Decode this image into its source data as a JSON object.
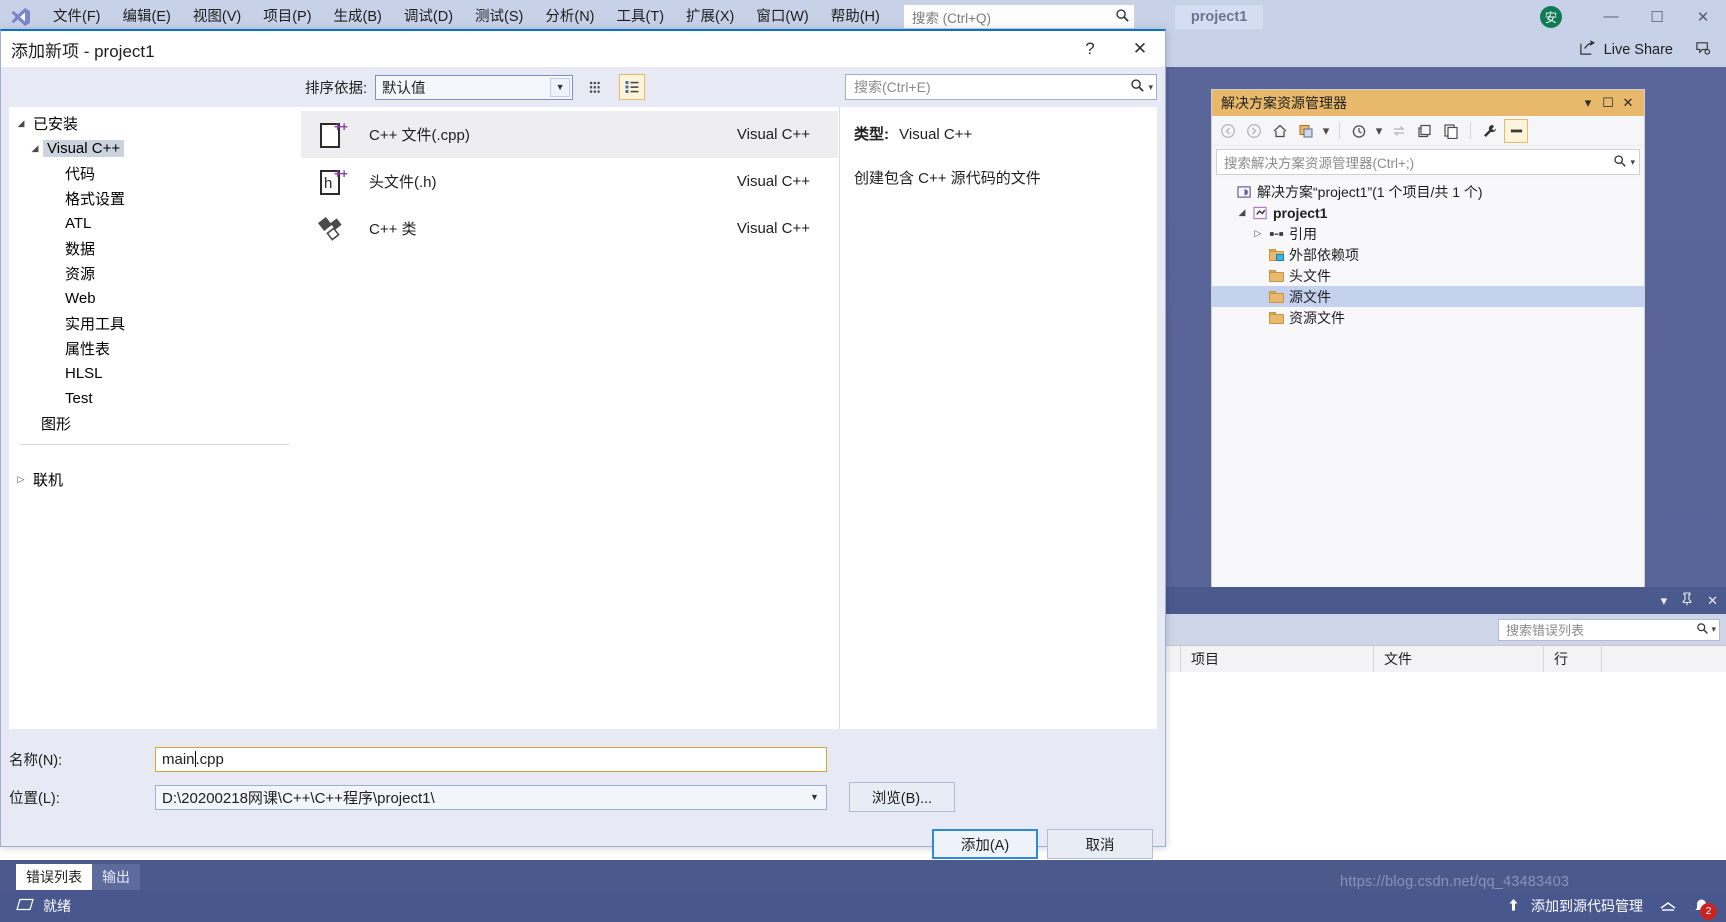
{
  "app": {
    "menu": [
      "文件(F)",
      "编辑(E)",
      "视图(V)",
      "项目(P)",
      "生成(B)",
      "调试(D)",
      "测试(S)",
      "分析(N)",
      "工具(T)",
      "扩展(X)",
      "窗口(W)",
      "帮助(H)"
    ],
    "search_placeholder": "搜索 (Ctrl+Q)",
    "project_chip": "project1",
    "avatar_text": "安",
    "live_share": "Live Share",
    "window_buttons": {
      "minimize": "—",
      "maximize": "☐",
      "close": "✕"
    }
  },
  "solution_explorer": {
    "title": "解决方案资源管理器",
    "title_buttons": {
      "dropdown": "▾",
      "float": "☐",
      "close": "✕"
    },
    "search_placeholder": "搜索解决方案资源管理器(Ctrl+;)",
    "tree": [
      {
        "label": "解决方案“project1”(1 个项目/共 1 个)",
        "indent": 0,
        "icon": "solution-icon",
        "bold": false,
        "twisty": "",
        "selected": false
      },
      {
        "label": "project1",
        "indent": 1,
        "icon": "project-icon",
        "bold": true,
        "twisty": "◢",
        "selected": false
      },
      {
        "label": "引用",
        "indent": 2,
        "icon": "references-icon",
        "bold": false,
        "twisty": "▷",
        "selected": false
      },
      {
        "label": "外部依赖项",
        "indent": 2,
        "icon": "folder-link-icon",
        "bold": false,
        "twisty": "",
        "selected": false
      },
      {
        "label": "头文件",
        "indent": 2,
        "icon": "folder-icon",
        "bold": false,
        "twisty": "",
        "selected": false
      },
      {
        "label": "源文件",
        "indent": 2,
        "icon": "folder-icon",
        "bold": false,
        "twisty": "",
        "selected": true
      },
      {
        "label": "资源文件",
        "indent": 2,
        "icon": "folder-icon",
        "bold": false,
        "twisty": "",
        "selected": false
      }
    ]
  },
  "error_list": {
    "panel_buttons": {
      "dropdown": "▾",
      "pin": "⚗",
      "close": "✕"
    },
    "search_placeholder": "搜索错误列表",
    "columns": [
      "项目",
      "文件",
      "行"
    ]
  },
  "bottom_tabs": [
    {
      "label": "错误列表",
      "active": true
    },
    {
      "label": "输出",
      "active": false
    }
  ],
  "status_bar": {
    "ready": "就绪",
    "source_control": "添加到源代码管理",
    "notification_count": "2",
    "watermark": "https://blog.csdn.net/qq_43483403"
  },
  "dialog": {
    "title": "添加新项 - project1",
    "help_button": "?",
    "close_button": "✕",
    "sort_label": "排序依据:",
    "sort_value": "默认值",
    "search_placeholder": "搜索(Ctrl+E)",
    "categories": [
      {
        "label": "已安装",
        "level": 0,
        "twisty": "◢",
        "selected": false
      },
      {
        "label": "Visual C++",
        "level": 1,
        "twisty": "◢",
        "selected": true
      },
      {
        "label": "代码",
        "level": 2,
        "twisty": "",
        "selected": false
      },
      {
        "label": "格式设置",
        "level": 2,
        "twisty": "",
        "selected": false
      },
      {
        "label": "ATL",
        "level": 2,
        "twisty": "",
        "selected": false
      },
      {
        "label": "数据",
        "level": 2,
        "twisty": "",
        "selected": false
      },
      {
        "label": "资源",
        "level": 2,
        "twisty": "",
        "selected": false
      },
      {
        "label": "Web",
        "level": 2,
        "twisty": "",
        "selected": false
      },
      {
        "label": "实用工具",
        "level": 2,
        "twisty": "",
        "selected": false
      },
      {
        "label": "属性表",
        "level": 2,
        "twisty": "",
        "selected": false
      },
      {
        "label": "HLSL",
        "level": 2,
        "twisty": "",
        "selected": false
      },
      {
        "label": "Test",
        "level": 2,
        "twisty": "",
        "selected": false
      },
      {
        "label": "图形",
        "level": 1,
        "twisty": "",
        "selected": false
      }
    ],
    "online_category": {
      "label": "联机",
      "twisty": "▷"
    },
    "templates": [
      {
        "name": "C++ 文件(.cpp)",
        "source": "Visual C++",
        "icon": "cpp-file-icon",
        "selected": true
      },
      {
        "name": "头文件(.h)",
        "source": "Visual C++",
        "icon": "header-file-icon",
        "selected": false
      },
      {
        "name": "C++ 类",
        "source": "Visual C++",
        "icon": "cpp-class-icon",
        "selected": false
      }
    ],
    "description": {
      "type_label": "类型:",
      "type_value": "Visual C++",
      "text": "创建包含 C++ 源代码的文件"
    },
    "name_label": "名称(N):",
    "name_value_before_caret": "main",
    "name_value_after_caret": ".cpp",
    "location_label": "位置(L):",
    "location_value": "D:\\20200218网课\\C++\\C++程序\\project1\\",
    "browse_button": "浏览(B)...",
    "add_button": "添加(A)",
    "cancel_button": "取消"
  },
  "colors": {
    "accent_blue": "#0d72c4",
    "titlebar": "#c7d1e8",
    "sln_title": "#e8b96b",
    "selection": "#c5d2ef",
    "status_bar": "#48588f",
    "desktop": "#5a659a"
  }
}
